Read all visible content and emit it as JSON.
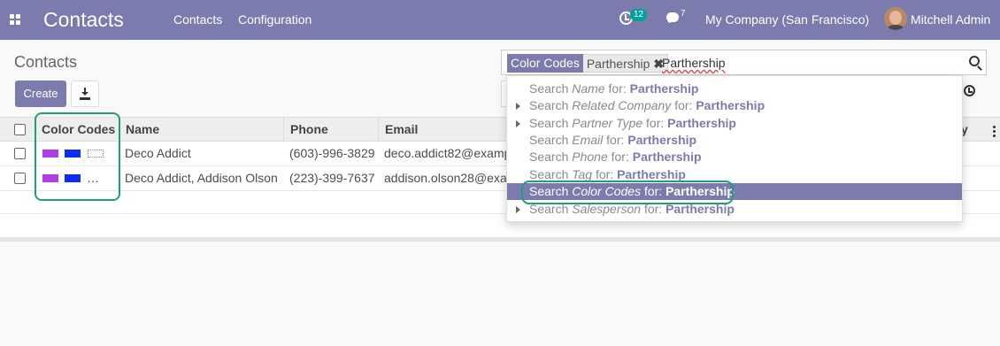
{
  "navbar": {
    "apps_icon": "grid-icon",
    "brand": "Contacts",
    "menu": [
      "Contacts",
      "Configuration"
    ],
    "activity_count": "12",
    "messages_count": "7",
    "company": "My Company (San Francisco)",
    "user": "Mitchell Admin",
    "accent": "#7c7bad"
  },
  "control": {
    "title": "Contacts",
    "create_label": "Create",
    "download_icon": "download-icon"
  },
  "search": {
    "facet_category": "Color Codes",
    "facet_value": "Parthership",
    "facet_remove": "✖",
    "input_value": "Parthership",
    "search_icon": "magnifier-icon"
  },
  "table": {
    "headers": [
      "Color Codes",
      "Name",
      "Phone",
      "Email"
    ],
    "header_fragment": "y",
    "rows": [
      {
        "colors": [
          "#b43ce6",
          "#0a2cf4",
          "dotted"
        ],
        "name": "Deco Addict",
        "phone": "(603)-996-3829",
        "email": "deco.addict82@exampl"
      },
      {
        "colors": [
          "#b43ce6",
          "#0a2cf4"
        ],
        "more": "…",
        "name": "Deco Addict, Addison Olson",
        "phone": "(223)-399-7637",
        "email": "addison.olson28@exam"
      }
    ]
  },
  "dropdown": {
    "items": [
      {
        "prefix": "Search ",
        "field": "Name",
        "mid": " for: ",
        "value": "Parthership",
        "expandable": false,
        "active": false
      },
      {
        "prefix": "Search ",
        "field": "Related Company",
        "mid": " for: ",
        "value": "Parthership",
        "expandable": true,
        "active": false
      },
      {
        "prefix": "Search ",
        "field": "Partner Type",
        "mid": " for: ",
        "value": "Parthership",
        "expandable": true,
        "active": false
      },
      {
        "prefix": "Search ",
        "field": "Email",
        "mid": " for: ",
        "value": "Parthership",
        "expandable": false,
        "active": false
      },
      {
        "prefix": "Search ",
        "field": "Phone",
        "mid": " for: ",
        "value": "Parthership",
        "expandable": false,
        "active": false
      },
      {
        "prefix": "Search ",
        "field": "Tag",
        "mid": " for: ",
        "value": "Parthership",
        "expandable": false,
        "active": false
      },
      {
        "prefix": "Search ",
        "field": "Color Codes",
        "mid": " for: ",
        "value": "Parthership",
        "expandable": false,
        "active": true
      },
      {
        "prefix": "Search ",
        "field": "Salesperson",
        "mid": " for: ",
        "value": "Parthership",
        "expandable": true,
        "active": false
      }
    ]
  },
  "highlight_color": "#1e9e7a"
}
